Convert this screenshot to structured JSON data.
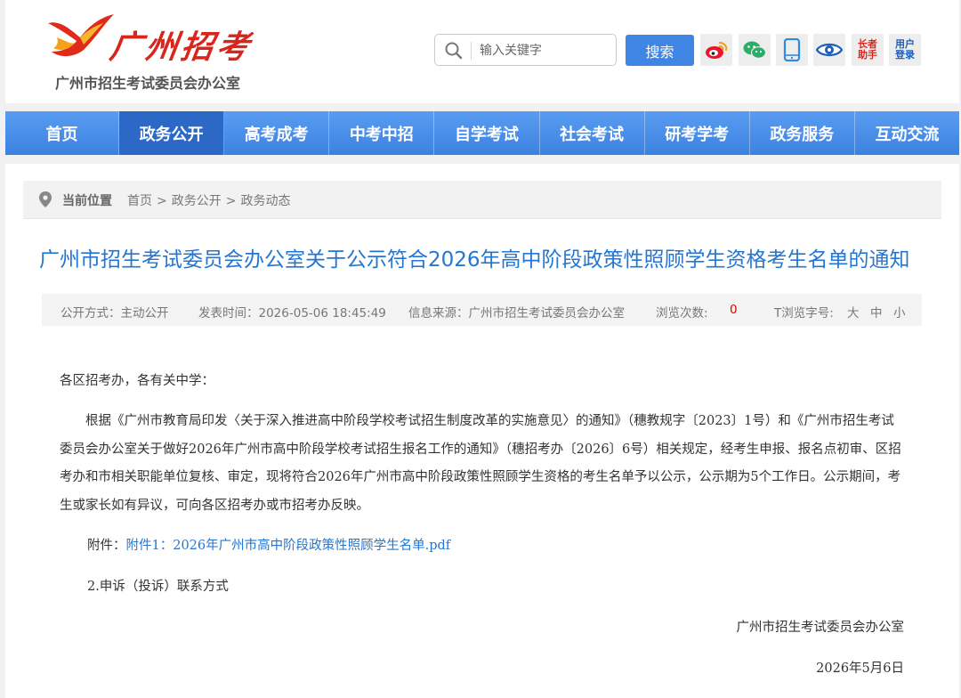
{
  "brand": {
    "logo_text": "广州招考",
    "org_name": "广州市招生考试委员会办公室"
  },
  "search": {
    "placeholder": "输入关键字",
    "button_label": "搜索"
  },
  "top_icons": [
    {
      "icon": "weibo-icon"
    },
    {
      "icon": "wechat-icon"
    },
    {
      "icon": "mobile-icon"
    },
    {
      "icon": "eye-icon"
    },
    {
      "icon": "elder-assistant-icon",
      "label_line1": "长者",
      "label_line2": "助手"
    },
    {
      "icon": "user-login-icon",
      "label_line1": "用户",
      "label_line2": "登录"
    }
  ],
  "nav": {
    "items": [
      {
        "label": "首页"
      },
      {
        "label": "政务公开",
        "active": true
      },
      {
        "label": "高考成考"
      },
      {
        "label": "中考中招"
      },
      {
        "label": "自学考试"
      },
      {
        "label": "社会考试"
      },
      {
        "label": "研考学考"
      },
      {
        "label": "政务服务"
      },
      {
        "label": "互动交流"
      }
    ]
  },
  "breadcrumb": {
    "label": "当前位置",
    "items": [
      "首页",
      "政务公开",
      "政务动态"
    ],
    "separator": ">"
  },
  "article": {
    "title": "广州市招生考试委员会办公室关于公示符合2026年高中阶段政策性照顾学生资格考生名单的通知",
    "meta": {
      "disclosure": "公开方式：主动公开",
      "published": "发表时间：2026-05-06 18:45:49",
      "source": "信息来源：广州市招生考试委员会办公室",
      "views_label": "浏览次数:",
      "views_count": "0",
      "font_size_label": "T浏览字号:",
      "font_sizes": [
        "大",
        "中",
        "小"
      ]
    },
    "greeting": "各区招考办，各有关中学：",
    "paragraph": "根据《广州市教育局印发〈关于深入推进高中阶段学校考试招生制度改革的实施意见〉的通知》（穗教规字〔2023〕1号）和《广州市招生考试委员会办公室关于做好2026年广州市高中阶段学校考试招生报名工作的通知》（穗招考办〔2026〕6号）相关规定，经考生申报、报名点初审、区招考办和市相关职能单位复核、审定，现将符合2026年广州市高中阶段政策性照顾学生资格的考生名单予以公示，公示期为5个工作日。公示期间，考生或家长如有异议，可向各区招考办或市招考办反映。",
    "attachment_label": "附件：",
    "attachment_link": "附件1：2026年广州市高中阶段政策性照顾学生名单.pdf",
    "appeal": "2.申诉（投诉）联系方式",
    "signature_org": "广州市招生考试委员会办公室",
    "signature_date": "2026年5月6日"
  },
  "colors": {
    "nav_bg": "#3f86e4",
    "nav_active": "#2c69c6",
    "title_blue": "#2476d3",
    "logo_red": "#d8261c"
  }
}
